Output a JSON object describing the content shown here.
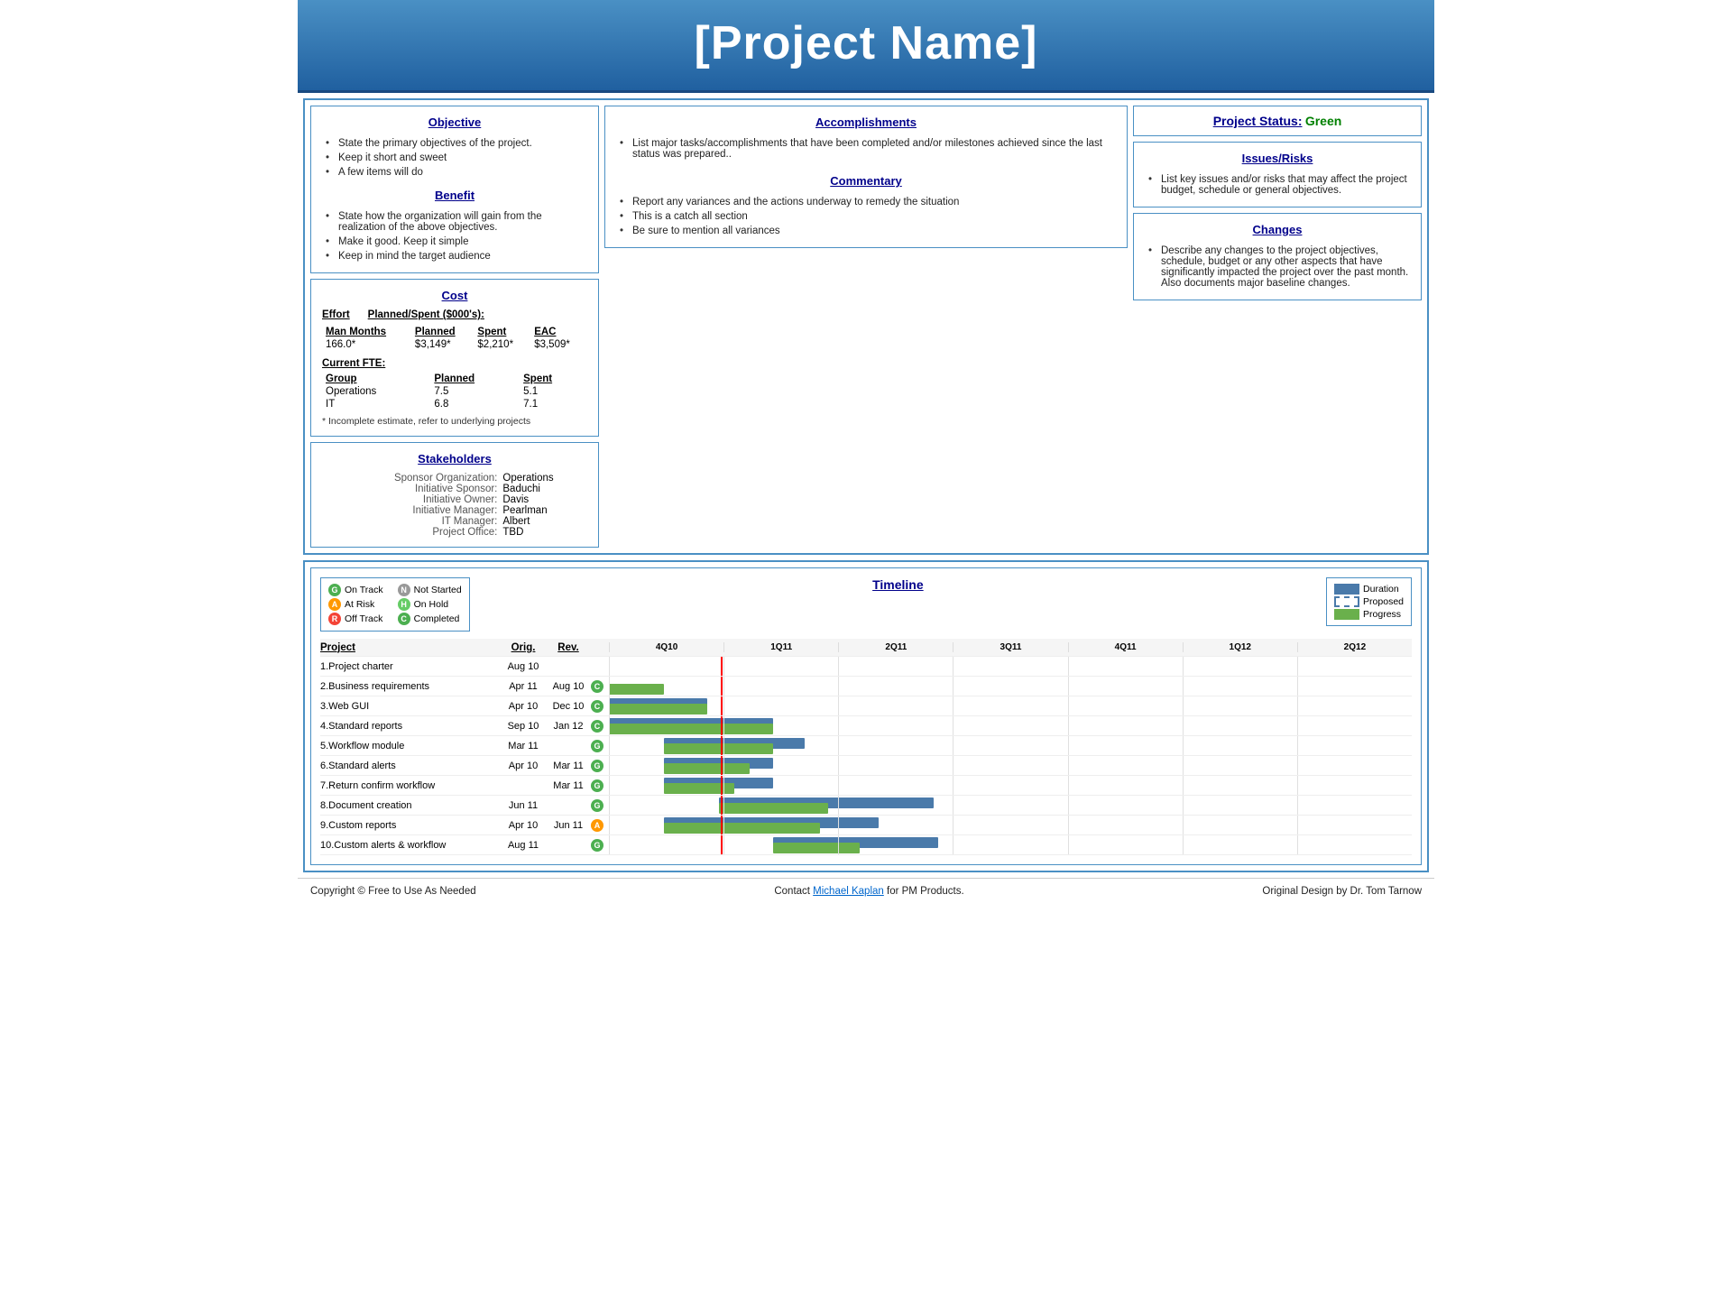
{
  "header": {
    "title": "[Project Name]"
  },
  "objective": {
    "title": "Objective",
    "bullets": [
      "State the primary objectives  of the project.",
      "Keep it short and sweet",
      "A few items will do"
    ]
  },
  "benefit": {
    "title": "Benefit",
    "bullets": [
      "State how the organization will gain from the realization of the above  objectives.",
      "Make it good. Keep it simple",
      "Keep in mind the target audience"
    ]
  },
  "cost": {
    "title": "Cost",
    "effort_label": "Effort",
    "planned_spent_label": "Planned/Spent ($000's):",
    "cols": [
      "Man Months",
      "Planned",
      "Spent",
      "EAC"
    ],
    "row": [
      "166.0*",
      "$3,149*",
      "$2,210*",
      "$3,509*"
    ],
    "current_fte_label": "Current FTE:",
    "fte_cols": [
      "Group",
      "Planned",
      "Spent"
    ],
    "fte_rows": [
      [
        "Operations",
        "7.5",
        "5.1"
      ],
      [
        "IT",
        "6.8",
        "7.1"
      ]
    ],
    "note": "* Incomplete estimate, refer to underlying projects"
  },
  "stakeholders": {
    "title": "Stakeholders",
    "rows": [
      {
        "label": "Sponsor Organization:",
        "value": "Operations"
      },
      {
        "label": "Initiative Sponsor:",
        "value": "Baduchi"
      },
      {
        "label": "Initiative Owner:",
        "value": "Davis"
      },
      {
        "label": "Initiative Manager:",
        "value": "Pearlman"
      },
      {
        "label": "IT Manager:",
        "value": "Albert"
      },
      {
        "label": "Project Office:",
        "value": "TBD"
      }
    ]
  },
  "accomplishments": {
    "title": "Accomplishments",
    "bullets": [
      "List major tasks/accomplishments that have  been completed and/or milestones achieved  since the last status was prepared.."
    ]
  },
  "commentary": {
    "title": "Commentary",
    "bullets": [
      "Report any variances  and the actions underway to remedy the situation",
      "This is a catch all section",
      "Be  sure to mention all variances"
    ]
  },
  "project_status": {
    "title": "Project Status:",
    "value": "Green"
  },
  "issues_risks": {
    "title": "Issues/Risks",
    "bullets": [
      "List key issues and/or risks that may affect the project budget, schedule or general objectives."
    ]
  },
  "changes": {
    "title": "Changes",
    "bullets": [
      "Describe any changes to the project objectives, schedule, budget or any other aspects that have significantly impacted the project over the past month. Also documents major baseline  changes."
    ]
  },
  "legend": {
    "items_left": [
      {
        "color": "#4caf50",
        "letter": "G",
        "label": "On Track"
      },
      {
        "color": "#ff9800",
        "letter": "A",
        "label": "At Risk"
      },
      {
        "color": "#f44336",
        "letter": "R",
        "label": "Off Track"
      }
    ],
    "items_right": [
      {
        "color": "#999",
        "letter": "N",
        "label": "Not Started"
      },
      {
        "color": "#6c6",
        "letter": "H",
        "label": "On Hold"
      },
      {
        "color": "#4caf50",
        "letter": "C",
        "label": "Completed"
      }
    ],
    "chart_legend": [
      {
        "type": "solid",
        "label": "Duration"
      },
      {
        "type": "dashed",
        "label": "Proposed"
      },
      {
        "type": "progress",
        "label": "Progress"
      }
    ]
  },
  "timeline": {
    "title": "Timeline",
    "columns": [
      "4Q10",
      "1Q11",
      "2Q11",
      "3Q11",
      "4Q11",
      "1Q12",
      "2Q12"
    ],
    "projects": [
      {
        "id": "1",
        "name": "1.Project charter",
        "orig": "Aug 10",
        "rev": "",
        "status": "",
        "bars": []
      },
      {
        "id": "2",
        "name": "2.Business requirements",
        "orig": "Apr 11",
        "rev": "Aug 10",
        "status": "C",
        "status_color": "#4caf50",
        "bars": [
          {
            "type": "progress",
            "start": 0,
            "width": 0.14
          }
        ]
      },
      {
        "id": "3",
        "name": "3.Web GUI",
        "orig": "Apr 10",
        "rev": "Dec 10",
        "status": "C",
        "status_color": "#4caf50",
        "bars": [
          {
            "type": "duration",
            "start": 0,
            "width": 0.25
          },
          {
            "type": "progress",
            "start": 0,
            "width": 0.25
          }
        ]
      },
      {
        "id": "4",
        "name": "4.Standard reports",
        "orig": "Sep 10",
        "rev": "Jan 12",
        "status": "C",
        "status_color": "#4caf50",
        "bars": [
          {
            "type": "duration",
            "start": 0,
            "width": 0.42
          },
          {
            "type": "progress",
            "start": 0,
            "width": 0.42
          }
        ]
      },
      {
        "id": "5",
        "name": "5.Workflow module",
        "orig": "Mar 11",
        "rev": "",
        "status": "G",
        "status_color": "#4caf50",
        "bars": [
          {
            "type": "duration",
            "start": 0.14,
            "width": 0.36
          },
          {
            "type": "progress",
            "start": 0.14,
            "width": 0.28
          }
        ]
      },
      {
        "id": "6",
        "name": "6.Standard alerts",
        "orig": "Apr 10",
        "rev": "Mar 11",
        "status": "G",
        "status_color": "#4caf50",
        "bars": [
          {
            "type": "duration",
            "start": 0.14,
            "width": 0.28
          },
          {
            "type": "progress",
            "start": 0.14,
            "width": 0.22
          }
        ]
      },
      {
        "id": "7",
        "name": "7.Return confirm workflow",
        "orig": "",
        "rev": "Mar 11",
        "status": "G",
        "status_color": "#4caf50",
        "bars": [
          {
            "type": "duration",
            "start": 0.14,
            "width": 0.28
          },
          {
            "type": "progress",
            "start": 0.14,
            "width": 0.18
          }
        ]
      },
      {
        "id": "8",
        "name": "8.Document creation",
        "orig": "Jun 11",
        "rev": "",
        "status": "G",
        "status_color": "#4caf50",
        "bars": [
          {
            "type": "duration",
            "start": 0.28,
            "width": 0.55
          },
          {
            "type": "progress",
            "start": 0.28,
            "width": 0.28
          }
        ]
      },
      {
        "id": "9",
        "name": "9.Custom reports",
        "orig": "Apr 10",
        "rev": "Jun 11",
        "status": "A",
        "status_color": "#ff9800",
        "bars": [
          {
            "type": "duration",
            "start": 0.14,
            "width": 0.55
          },
          {
            "type": "progress",
            "start": 0.14,
            "width": 0.4
          }
        ]
      },
      {
        "id": "10",
        "name": "10.Custom alerts & workflow",
        "orig": "Aug 11",
        "rev": "",
        "status": "G",
        "status_color": "#4caf50",
        "bars": [
          {
            "type": "duration",
            "start": 0.42,
            "width": 0.42
          },
          {
            "type": "progress",
            "start": 0.42,
            "width": 0.22
          }
        ]
      }
    ],
    "today_position": 0.285
  },
  "footer": {
    "left": "Copyright © Free to  Use As Needed",
    "center_pre": "Contact ",
    "center_link": "Michael Kaplan",
    "center_post": " for PM Products.",
    "right": "Original Design by Dr. Tom Tarnow"
  }
}
